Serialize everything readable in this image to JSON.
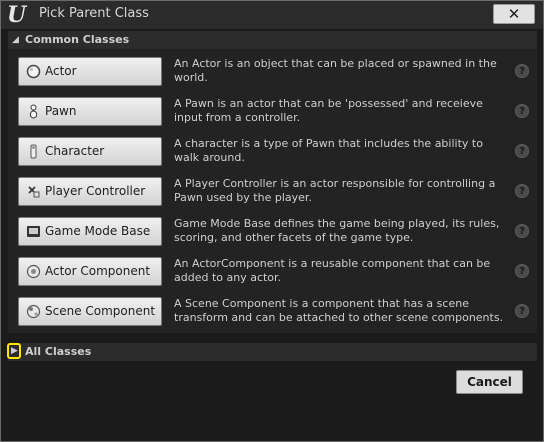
{
  "window": {
    "title": "Pick Parent Class",
    "close_glyph": "✕"
  },
  "sections": {
    "common_title": "Common Classes",
    "all_title": "All Classes"
  },
  "classes": [
    {
      "name": "Actor",
      "icon": "sphere-icon",
      "description": "An Actor is an object that can be placed or spawned in the world."
    },
    {
      "name": "Pawn",
      "icon": "pawn-icon",
      "description": "A Pawn is an actor that can be 'possessed' and receieve input from a controller."
    },
    {
      "name": "Character",
      "icon": "character-icon",
      "description": "A character is a type of Pawn that includes the ability to walk around."
    },
    {
      "name": "Player Controller",
      "icon": "controller-icon",
      "description": "A Player Controller is an actor responsible for controlling a Pawn used by the player."
    },
    {
      "name": "Game Mode Base",
      "icon": "game-mode-icon",
      "description": "Game Mode Base defines the game being played, its rules, scoring, and other facets of the game type."
    },
    {
      "name": "Actor Component",
      "icon": "actor-component-icon",
      "description": "An ActorComponent is a reusable component that can be added to any actor."
    },
    {
      "name": "Scene Component",
      "icon": "scene-component-icon",
      "description": "A Scene Component is a component that has a scene transform and can be attached to other scene components."
    }
  ],
  "help_glyph": "?",
  "footer": {
    "cancel_label": "Cancel"
  },
  "colors": {
    "highlight": "#ffe700",
    "background": "#1b1b1b",
    "panel": "#232323"
  }
}
